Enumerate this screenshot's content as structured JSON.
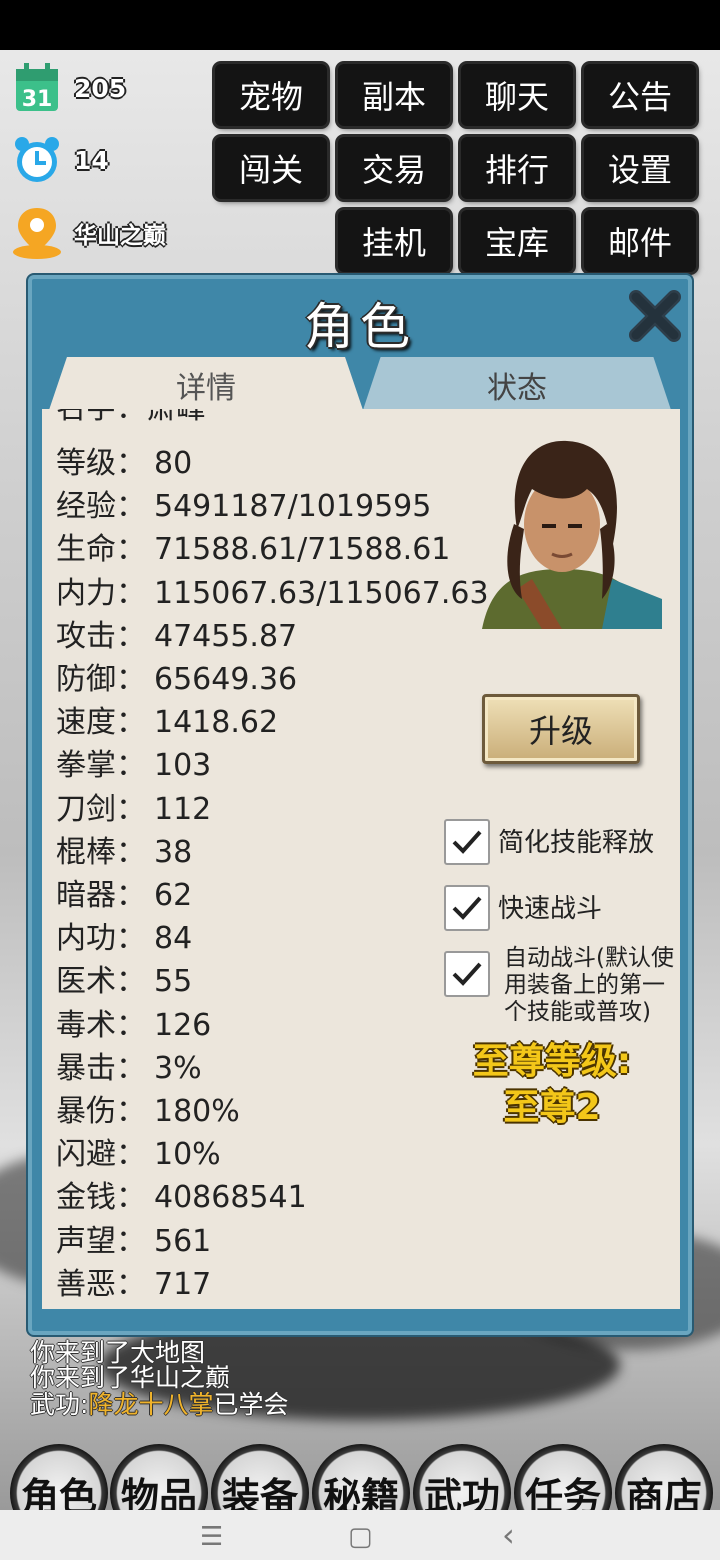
{
  "top_stats": [
    {
      "icon": "calendar-icon",
      "value": "205",
      "cal_day": "31"
    },
    {
      "icon": "alarm-clock-icon",
      "value": "14"
    },
    {
      "icon": "location-pin-icon",
      "value": "华山之巅"
    }
  ],
  "menu": {
    "row1": [
      "宠物",
      "副本",
      "聊天",
      "公告"
    ],
    "row2": [
      "闯关",
      "交易",
      "排行",
      "设置"
    ],
    "row3": [
      "挂机",
      "宝库",
      "邮件"
    ]
  },
  "panel": {
    "title": "角色",
    "close_icon": "close-x-icon",
    "tabs": [
      "详情",
      "状态"
    ]
  },
  "stats_partial": "名字：萧峰",
  "stats": [
    {
      "label": "等级：",
      "value": "80"
    },
    {
      "label": "经验：",
      "value": "5491187/1019595"
    },
    {
      "label": "生命：",
      "value": "71588.61/71588.61"
    },
    {
      "label": "内力：",
      "value": "115067.63/115067.63"
    },
    {
      "label": "攻击：",
      "value": "47455.87"
    },
    {
      "label": "防御：",
      "value": "65649.36"
    },
    {
      "label": "速度：",
      "value": "1418.62"
    },
    {
      "label": "拳掌：",
      "value": "103"
    },
    {
      "label": "刀剑：",
      "value": "112"
    },
    {
      "label": "棍棒：",
      "value": "38"
    },
    {
      "label": "暗器：",
      "value": "62"
    },
    {
      "label": "内功：",
      "value": "84"
    },
    {
      "label": "医术：",
      "value": "55"
    },
    {
      "label": "毒术：",
      "value": "126"
    },
    {
      "label": "暴击：",
      "value": "3%"
    },
    {
      "label": "暴伤：",
      "value": "180%"
    },
    {
      "label": "闪避：",
      "value": "10%"
    },
    {
      "label": "金钱：",
      "value": "40868541"
    },
    {
      "label": "声望：",
      "value": "561"
    },
    {
      "label": "善恶：",
      "value": "717"
    }
  ],
  "upgrade_label": "升级",
  "options": [
    {
      "label": "简化技能释放",
      "checked": true
    },
    {
      "label": "快速战斗",
      "checked": true
    },
    {
      "label": "自动战斗(默认使用装备上的第一个技能或普攻)",
      "lines": [
        "自动战斗(默认使",
        "用装备上的第一",
        "个技能或普攻)"
      ],
      "checked": true
    }
  ],
  "supreme": {
    "line1": "至尊等级:",
    "line2": "至尊2"
  },
  "log": {
    "line1": "你来到了大地图",
    "line2": "你来到了华山之巅",
    "line3_prefix": "武功:",
    "line3_skill": "降龙十八掌",
    "line3_suffix": "已学会"
  },
  "bottom_nav": [
    "角色",
    "物品",
    "装备",
    "秘籍",
    "武功",
    "任务",
    "商店"
  ],
  "system_nav": {
    "menu": "☰",
    "home": "▢",
    "back": "‹"
  },
  "colors": {
    "panel": "#3f87a8",
    "content": "#ece6dc",
    "supreme": "#f3c719",
    "highlight": "#f0b32a"
  }
}
